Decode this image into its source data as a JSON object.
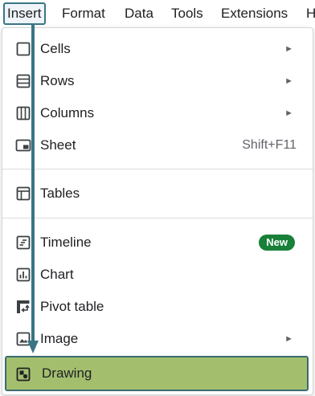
{
  "menubar": {
    "items": [
      {
        "label": "Insert",
        "active": true
      },
      {
        "label": "Format"
      },
      {
        "label": "Data"
      },
      {
        "label": "Tools"
      },
      {
        "label": "Extensions"
      },
      {
        "label": "H"
      }
    ]
  },
  "menu": {
    "items": [
      {
        "label": "Cells",
        "icon": "cells-icon",
        "submenu": true
      },
      {
        "label": "Rows",
        "icon": "rows-icon",
        "submenu": true
      },
      {
        "label": "Columns",
        "icon": "columns-icon",
        "submenu": true
      },
      {
        "label": "Sheet",
        "icon": "sheet-icon",
        "shortcut": "Shift+F11"
      },
      {
        "label": "Tables",
        "icon": "tables-icon"
      },
      {
        "label": "Timeline",
        "icon": "timeline-icon",
        "badge": "New"
      },
      {
        "label": "Chart",
        "icon": "chart-icon"
      },
      {
        "label": "Pivot table",
        "icon": "pivot-table-icon"
      },
      {
        "label": "Image",
        "icon": "image-icon",
        "submenu": true
      },
      {
        "label": "Drawing",
        "icon": "drawing-icon",
        "highlighted": true
      }
    ],
    "submenu_arrow": "►"
  },
  "colors": {
    "highlight": "#a3bf6e",
    "highlight_border": "#3b6b73",
    "annotation_arrow": "#3a7585",
    "badge": "#188038"
  }
}
